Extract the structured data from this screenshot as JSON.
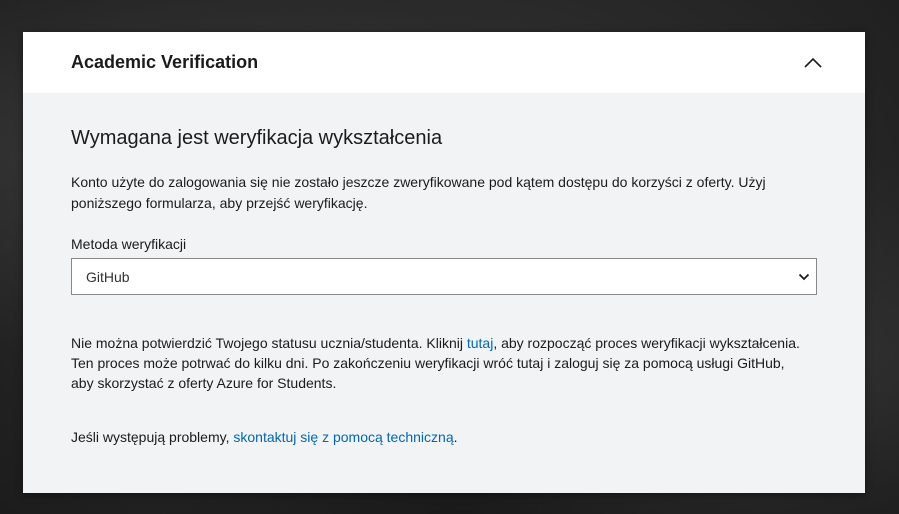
{
  "panel": {
    "title": "Academic Verification",
    "collapse_icon": "chevron-up-icon"
  },
  "content": {
    "heading": "Wymagana jest weryfikacja wykształcenia",
    "intro": "Konto użyte do zalogowania się nie zostało jeszcze zweryfikowane pod kątem dostępu do korzyści z oferty. Użyj poniższego formularza, aby przejść weryfikację.",
    "method": {
      "label": "Metoda weryfikacji",
      "selected": "GitHub",
      "dropdown_icon": "chevron-down-icon"
    },
    "status": {
      "before_link": "Nie można potwierdzić Twojego statusu ucznia/studenta. Kliknij ",
      "link_text": "tutaj",
      "after_link": ", aby rozpocząć proces weryfikacji wykształcenia. Ten proces może potrwać do kilku dni. Po zakończeniu weryfikacji wróć tutaj i zaloguj się za pomocą usługi GitHub, aby skorzystać z oferty Azure for Students."
    },
    "help": {
      "before_link": "Jeśli występują problemy, ",
      "link_text": "skontaktuj się z pomocą techniczną",
      "after_link": "."
    }
  },
  "colors": {
    "link": "#0067b8",
    "panel_background": "#f2f3f4",
    "header_background": "#ffffff"
  }
}
